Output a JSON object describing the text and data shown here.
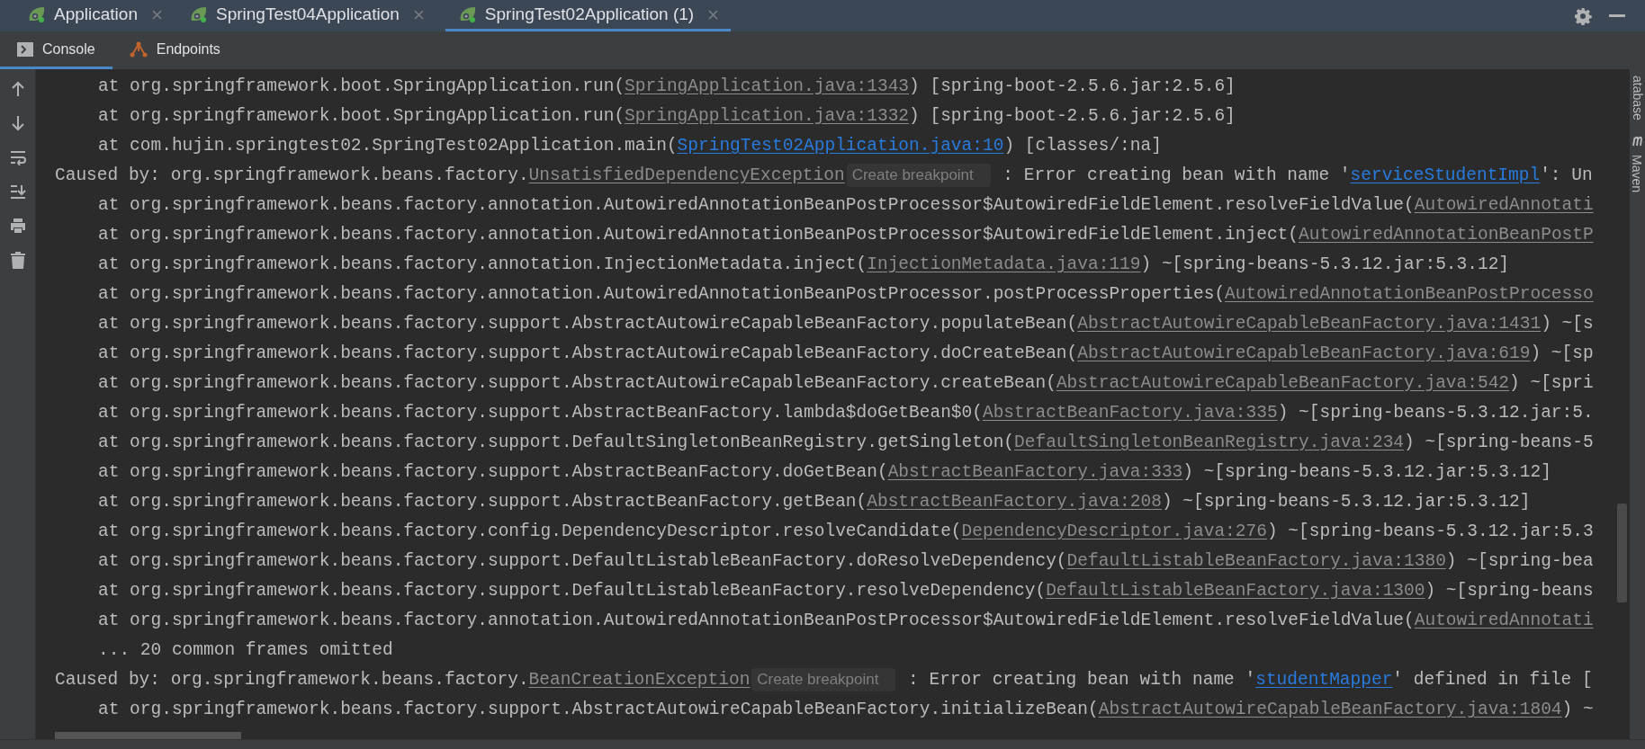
{
  "tabs": [
    {
      "label": "Application",
      "selected": false
    },
    {
      "label": "SpringTest04Application",
      "selected": false
    },
    {
      "label": "SpringTest02Application (1)",
      "selected": true
    }
  ],
  "tool_tabs": [
    {
      "label": "Console",
      "kind": "console",
      "selected": true
    },
    {
      "label": "Endpoints",
      "kind": "endpoints",
      "selected": false
    }
  ],
  "side_panels": [
    "atabase",
    "Maven"
  ],
  "console_lines": [
    {
      "kind": "frame",
      "segments": [
        {
          "kind": "text",
          "text": "at org.springframework.boot.SpringApplication.run("
        },
        {
          "kind": "source",
          "text": "SpringApplication.java:1343"
        },
        {
          "kind": "text",
          "text": ") [spring-boot-2.5.6.jar:2.5.6]"
        }
      ]
    },
    {
      "kind": "frame",
      "segments": [
        {
          "kind": "text",
          "text": "at org.springframework.boot.SpringApplication.run("
        },
        {
          "kind": "source",
          "text": "SpringApplication.java:1332"
        },
        {
          "kind": "text",
          "text": ") [spring-boot-2.5.6.jar:2.5.6]"
        }
      ]
    },
    {
      "kind": "frame",
      "segments": [
        {
          "kind": "text",
          "text": "at com.hujin.springtest02.SpringTest02Application.main("
        },
        {
          "kind": "link",
          "text": "SpringTest02Application.java:10"
        },
        {
          "kind": "text",
          "text": ") [classes/:na]"
        }
      ]
    },
    {
      "kind": "cause",
      "segments": [
        {
          "kind": "text",
          "text": "Caused by: org.springframework.beans.factory."
        },
        {
          "kind": "source",
          "text": "UnsatisfiedDependencyException"
        },
        {
          "kind": "hint",
          "text": "Create breakpoint"
        },
        {
          "kind": "text",
          "text": " : Error creating bean with name '"
        },
        {
          "kind": "link",
          "text": "serviceStudentImpl"
        },
        {
          "kind": "text",
          "text": "': Un"
        }
      ]
    },
    {
      "kind": "frame",
      "segments": [
        {
          "kind": "text",
          "text": "at org.springframework.beans.factory.annotation.AutowiredAnnotationBeanPostProcessor$AutowiredFieldElement.resolveFieldValue("
        },
        {
          "kind": "source",
          "text": "AutowiredAnnotati"
        }
      ]
    },
    {
      "kind": "frame",
      "segments": [
        {
          "kind": "text",
          "text": "at org.springframework.beans.factory.annotation.AutowiredAnnotationBeanPostProcessor$AutowiredFieldElement.inject("
        },
        {
          "kind": "source",
          "text": "AutowiredAnnotationBeanPostP"
        }
      ]
    },
    {
      "kind": "frame",
      "segments": [
        {
          "kind": "text",
          "text": "at org.springframework.beans.factory.annotation.InjectionMetadata.inject("
        },
        {
          "kind": "source",
          "text": "InjectionMetadata.java:119"
        },
        {
          "kind": "text",
          "text": ") ~[spring-beans-5.3.12.jar:5.3.12]"
        }
      ]
    },
    {
      "kind": "frame",
      "segments": [
        {
          "kind": "text",
          "text": "at org.springframework.beans.factory.annotation.AutowiredAnnotationBeanPostProcessor.postProcessProperties("
        },
        {
          "kind": "source",
          "text": "AutowiredAnnotationBeanPostProcesso"
        }
      ]
    },
    {
      "kind": "frame",
      "segments": [
        {
          "kind": "text",
          "text": "at org.springframework.beans.factory.support.AbstractAutowireCapableBeanFactory.populateBean("
        },
        {
          "kind": "source",
          "text": "AbstractAutowireCapableBeanFactory.java:1431"
        },
        {
          "kind": "text",
          "text": ") ~[s"
        }
      ]
    },
    {
      "kind": "frame",
      "segments": [
        {
          "kind": "text",
          "text": "at org.springframework.beans.factory.support.AbstractAutowireCapableBeanFactory.doCreateBean("
        },
        {
          "kind": "source",
          "text": "AbstractAutowireCapableBeanFactory.java:619"
        },
        {
          "kind": "text",
          "text": ") ~[sp"
        }
      ]
    },
    {
      "kind": "frame",
      "segments": [
        {
          "kind": "text",
          "text": "at org.springframework.beans.factory.support.AbstractAutowireCapableBeanFactory.createBean("
        },
        {
          "kind": "source",
          "text": "AbstractAutowireCapableBeanFactory.java:542"
        },
        {
          "kind": "text",
          "text": ") ~[spri"
        }
      ]
    },
    {
      "kind": "frame",
      "segments": [
        {
          "kind": "text",
          "text": "at org.springframework.beans.factory.support.AbstractBeanFactory.lambda$doGetBean$0("
        },
        {
          "kind": "source",
          "text": "AbstractBeanFactory.java:335"
        },
        {
          "kind": "text",
          "text": ") ~[spring-beans-5.3.12.jar:5."
        }
      ]
    },
    {
      "kind": "frame",
      "segments": [
        {
          "kind": "text",
          "text": "at org.springframework.beans.factory.support.DefaultSingletonBeanRegistry.getSingleton("
        },
        {
          "kind": "source",
          "text": "DefaultSingletonBeanRegistry.java:234"
        },
        {
          "kind": "text",
          "text": ") ~[spring-beans-5"
        }
      ]
    },
    {
      "kind": "frame",
      "segments": [
        {
          "kind": "text",
          "text": "at org.springframework.beans.factory.support.AbstractBeanFactory.doGetBean("
        },
        {
          "kind": "source",
          "text": "AbstractBeanFactory.java:333"
        },
        {
          "kind": "text",
          "text": ") ~[spring-beans-5.3.12.jar:5.3.12]"
        }
      ]
    },
    {
      "kind": "frame",
      "segments": [
        {
          "kind": "text",
          "text": "at org.springframework.beans.factory.support.AbstractBeanFactory.getBean("
        },
        {
          "kind": "source",
          "text": "AbstractBeanFactory.java:208"
        },
        {
          "kind": "text",
          "text": ") ~[spring-beans-5.3.12.jar:5.3.12]"
        }
      ]
    },
    {
      "kind": "frame",
      "segments": [
        {
          "kind": "text",
          "text": "at org.springframework.beans.factory.config.DependencyDescriptor.resolveCandidate("
        },
        {
          "kind": "source",
          "text": "DependencyDescriptor.java:276"
        },
        {
          "kind": "text",
          "text": ") ~[spring-beans-5.3.12.jar:5.3"
        }
      ]
    },
    {
      "kind": "frame",
      "segments": [
        {
          "kind": "text",
          "text": "at org.springframework.beans.factory.support.DefaultListableBeanFactory.doResolveDependency("
        },
        {
          "kind": "source",
          "text": "DefaultListableBeanFactory.java:1380"
        },
        {
          "kind": "text",
          "text": ") ~[spring-bea"
        }
      ]
    },
    {
      "kind": "frame",
      "segments": [
        {
          "kind": "text",
          "text": "at org.springframework.beans.factory.support.DefaultListableBeanFactory.resolveDependency("
        },
        {
          "kind": "source",
          "text": "DefaultListableBeanFactory.java:1300"
        },
        {
          "kind": "text",
          "text": ") ~[spring-beans"
        }
      ]
    },
    {
      "kind": "frame",
      "segments": [
        {
          "kind": "text",
          "text": "at org.springframework.beans.factory.annotation.AutowiredAnnotationBeanPostProcessor$AutowiredFieldElement.resolveFieldValue("
        },
        {
          "kind": "source",
          "text": "AutowiredAnnotati"
        }
      ]
    },
    {
      "kind": "frame",
      "segments": [
        {
          "kind": "text",
          "text": "... 20 common frames omitted"
        }
      ]
    },
    {
      "kind": "cause",
      "segments": [
        {
          "kind": "text",
          "text": "Caused by: org.springframework.beans.factory."
        },
        {
          "kind": "source",
          "text": "BeanCreationException"
        },
        {
          "kind": "hint",
          "text": "Create breakpoint"
        },
        {
          "kind": "text",
          "text": " : Error creating bean with name '"
        },
        {
          "kind": "link",
          "text": "studentMapper"
        },
        {
          "kind": "text",
          "text": "' defined in file ["
        }
      ]
    },
    {
      "kind": "frame",
      "segments": [
        {
          "kind": "text",
          "text": "at org.springframework.beans.factory.support.AbstractAutowireCapableBeanFactory.initializeBean("
        },
        {
          "kind": "source",
          "text": "AbstractAutowireCapableBeanFactory.java:1804"
        },
        {
          "kind": "text",
          "text": ") ~"
        }
      ]
    }
  ]
}
